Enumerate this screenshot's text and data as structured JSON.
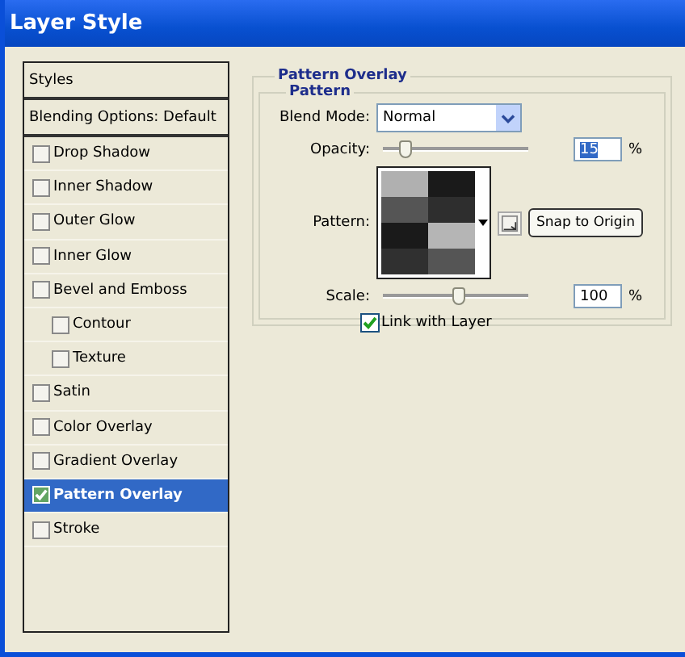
{
  "window": {
    "title": "Layer Style"
  },
  "sidebar": {
    "header": "Styles",
    "items": [
      {
        "label": "Blending Options: Default",
        "kind": "plain",
        "selected": false
      },
      {
        "label": "Drop Shadow",
        "kind": "check",
        "checked": false,
        "selected": false
      },
      {
        "label": "Inner Shadow",
        "kind": "check",
        "checked": false,
        "selected": false
      },
      {
        "label": "Outer Glow",
        "kind": "check",
        "checked": false,
        "selected": false
      },
      {
        "label": "Inner Glow",
        "kind": "check",
        "checked": false,
        "selected": false
      },
      {
        "label": "Bevel and Emboss",
        "kind": "check",
        "checked": false,
        "selected": false,
        "children": [
          {
            "label": "Contour",
            "kind": "check",
            "checked": false,
            "selected": false
          },
          {
            "label": "Texture",
            "kind": "check",
            "checked": false,
            "selected": false
          }
        ]
      },
      {
        "label": "Satin",
        "kind": "check",
        "checked": false,
        "selected": false
      },
      {
        "label": "Color Overlay",
        "kind": "check",
        "checked": false,
        "selected": false
      },
      {
        "label": "Gradient Overlay",
        "kind": "check",
        "checked": false,
        "selected": false
      },
      {
        "label": "Pattern Overlay",
        "kind": "check",
        "checked": true,
        "selected": true
      },
      {
        "label": "Stroke",
        "kind": "check",
        "checked": false,
        "selected": false
      }
    ]
  },
  "panel": {
    "title": "Pattern Overlay",
    "group": "Pattern",
    "blend_mode": {
      "label": "Blend Mode:",
      "value": "Normal"
    },
    "opacity": {
      "label": "Opacity:",
      "level": 0.15,
      "value": "15",
      "unit": "%"
    },
    "pattern": {
      "label": "Pattern:",
      "button": "Snap to Origin"
    },
    "scale": {
      "label": "Scale:",
      "level": 0.52,
      "value": "100",
      "unit": "%"
    },
    "link": {
      "label": "Link with Layer",
      "checked": true
    }
  }
}
